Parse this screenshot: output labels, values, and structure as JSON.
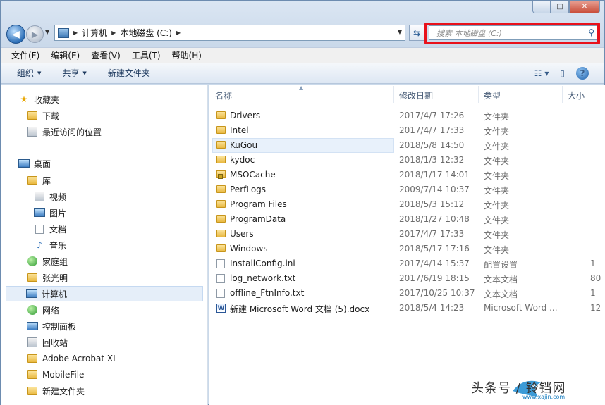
{
  "window": {
    "caption": {
      "minimize": "─",
      "maximize": "□",
      "close": "✕"
    }
  },
  "nav": {
    "breadcrumb": [
      "计算机",
      "本地磁盘 (C:)"
    ],
    "search_placeholder": "搜索 本地磁盘 (C:)"
  },
  "menu": [
    "文件(F)",
    "编辑(E)",
    "查看(V)",
    "工具(T)",
    "帮助(H)"
  ],
  "toolbar": {
    "organize": "组织",
    "share": "共享",
    "new_folder": "新建文件夹"
  },
  "sidebar": [
    {
      "label": "收藏夹",
      "icon": "star"
    },
    {
      "label": "下载",
      "icon": "folder"
    },
    {
      "label": "最近访问的位置",
      "icon": "recent"
    },
    {
      "label": "桌面",
      "icon": "desktop"
    },
    {
      "label": "库",
      "icon": "library"
    },
    {
      "label": "视频",
      "icon": "video"
    },
    {
      "label": "图片",
      "icon": "picture"
    },
    {
      "label": "文档",
      "icon": "document"
    },
    {
      "label": "音乐",
      "icon": "music"
    },
    {
      "label": "家庭组",
      "icon": "homegroup"
    },
    {
      "label": "张光明",
      "icon": "user"
    },
    {
      "label": "计算机",
      "icon": "computer",
      "selected": true
    },
    {
      "label": "网络",
      "icon": "network"
    },
    {
      "label": "控制面板",
      "icon": "control-panel"
    },
    {
      "label": "回收站",
      "icon": "recycle-bin"
    },
    {
      "label": "Adobe Acrobat XI",
      "icon": "folder"
    },
    {
      "label": "MobileFile",
      "icon": "folder"
    },
    {
      "label": "新建文件夹",
      "icon": "folder"
    }
  ],
  "columns": {
    "name": "名称",
    "date": "修改日期",
    "type": "类型",
    "size": "大小"
  },
  "files": [
    {
      "name": "Drivers",
      "date": "2017/4/7 17:26",
      "type": "文件夹",
      "size": "",
      "icon": "folder"
    },
    {
      "name": "Intel",
      "date": "2017/4/7 17:33",
      "type": "文件夹",
      "size": "",
      "icon": "folder"
    },
    {
      "name": "KuGou",
      "date": "2018/5/8 14:50",
      "type": "文件夹",
      "size": "",
      "icon": "folder",
      "selected": true
    },
    {
      "name": "kydoc",
      "date": "2018/1/3 12:32",
      "type": "文件夹",
      "size": "",
      "icon": "folder"
    },
    {
      "name": "MSOCache",
      "date": "2018/1/17 14:01",
      "type": "文件夹",
      "size": "",
      "icon": "locked-folder"
    },
    {
      "name": "PerfLogs",
      "date": "2009/7/14 10:37",
      "type": "文件夹",
      "size": "",
      "icon": "folder"
    },
    {
      "name": "Program Files",
      "date": "2018/5/3 15:12",
      "type": "文件夹",
      "size": "",
      "icon": "folder"
    },
    {
      "name": "ProgramData",
      "date": "2018/1/27 10:48",
      "type": "文件夹",
      "size": "",
      "icon": "folder"
    },
    {
      "name": "Users",
      "date": "2017/4/7 17:33",
      "type": "文件夹",
      "size": "",
      "icon": "folder"
    },
    {
      "name": "Windows",
      "date": "2018/5/17 17:16",
      "type": "文件夹",
      "size": "",
      "icon": "folder"
    },
    {
      "name": "InstallConfig.ini",
      "date": "2017/4/14 15:37",
      "type": "配置设置",
      "size": "1",
      "icon": "ini"
    },
    {
      "name": "log_network.txt",
      "date": "2017/6/19 18:15",
      "type": "文本文档",
      "size": "80",
      "icon": "txt"
    },
    {
      "name": "offline_FtnInfo.txt",
      "date": "2017/10/25 10:37",
      "type": "文本文档",
      "size": "1",
      "icon": "txt"
    },
    {
      "name": "新建 Microsoft Word 文档 (5).docx",
      "date": "2018/5/4 14:23",
      "type": "Microsoft Word ...",
      "size": "12",
      "icon": "word"
    }
  ],
  "watermark": {
    "text": "头条号 / 铃铛网",
    "url": "www.xajjn.com"
  },
  "colors": {
    "highlight": "#e8111b",
    "accent": "#2d6fb7"
  }
}
